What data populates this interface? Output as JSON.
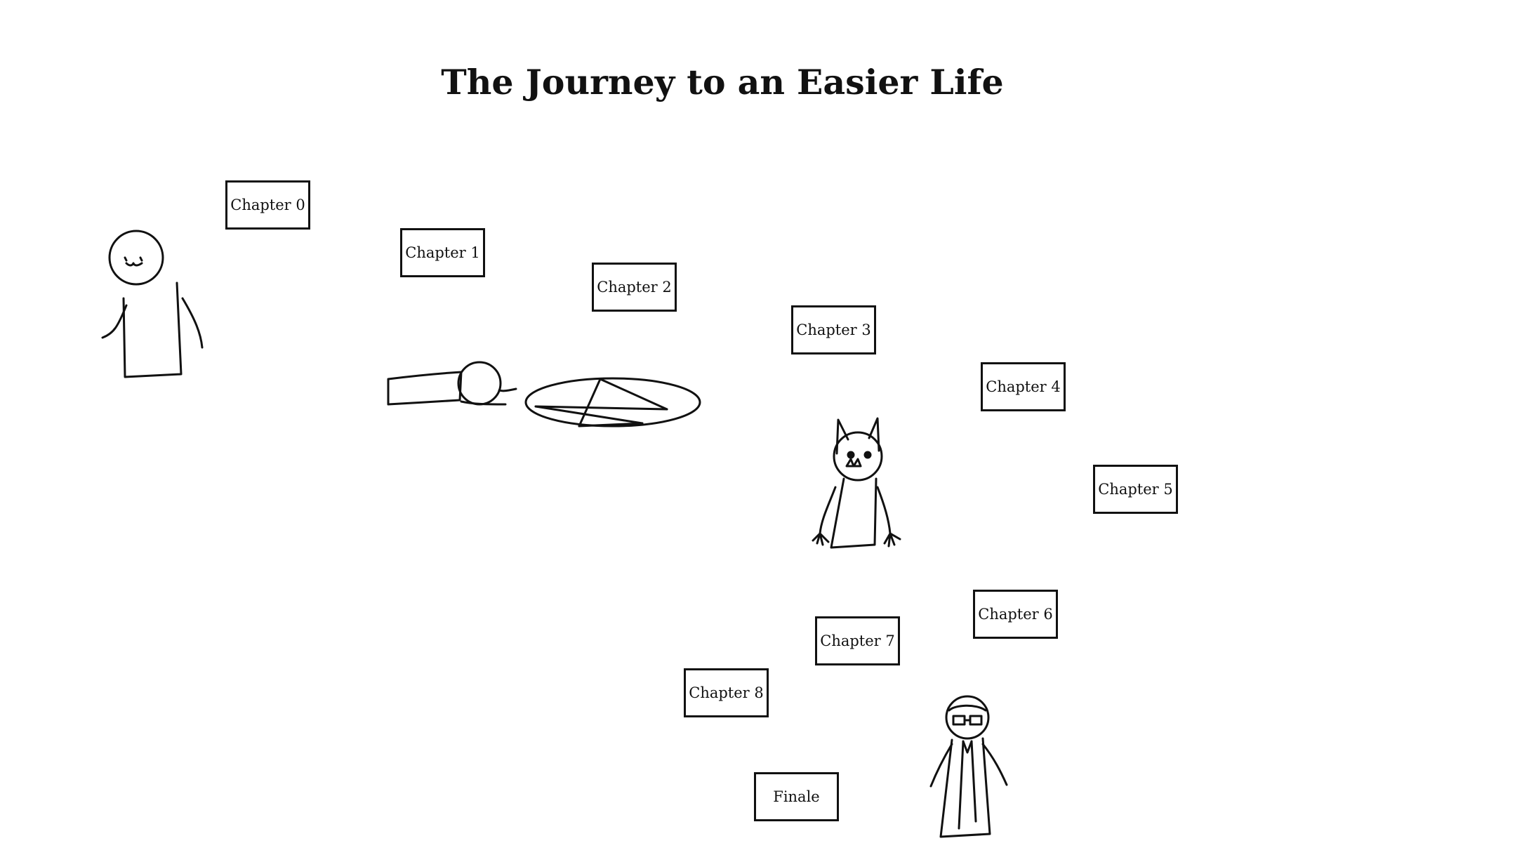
{
  "title": "The Journey to an Easier Life",
  "chapters": [
    {
      "label": "Chapter 0"
    },
    {
      "label": "Chapter 1"
    },
    {
      "label": "Chapter 2"
    },
    {
      "label": "Chapter 3"
    },
    {
      "label": "Chapter 4"
    },
    {
      "label": "Chapter 5"
    },
    {
      "label": "Chapter 6"
    },
    {
      "label": "Chapter 7"
    },
    {
      "label": "Chapter 8"
    },
    {
      "label": "Finale"
    }
  ],
  "illustrations": [
    {
      "name": "smiling-stick-figure-drawing"
    },
    {
      "name": "lying-figure-drawing"
    },
    {
      "name": "pentagram-circle-drawing"
    },
    {
      "name": "horned-demon-drawing"
    },
    {
      "name": "figure-with-glasses-drawing"
    }
  ]
}
